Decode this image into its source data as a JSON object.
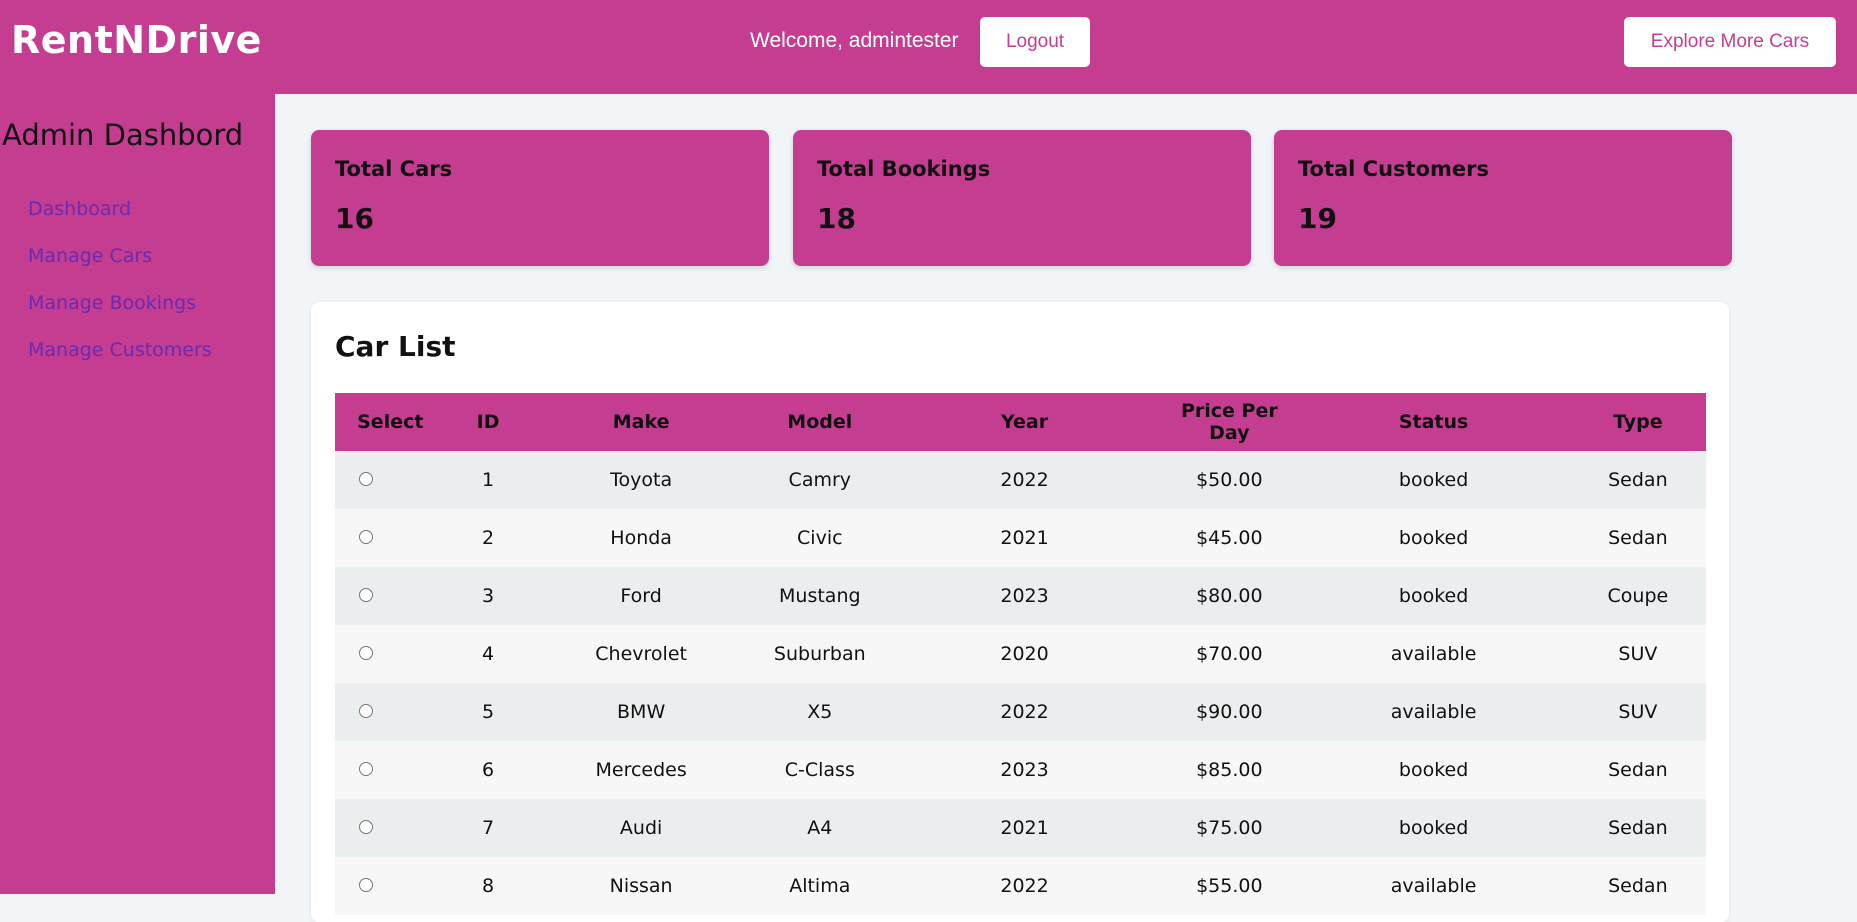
{
  "header": {
    "brand": "RentNDrive",
    "welcome": "Welcome, admintester",
    "logout_label": "Logout",
    "explore_label": "Explore More Cars"
  },
  "sidebar": {
    "title": "Admin Dashbord",
    "items": [
      {
        "label": "Dashboard"
      },
      {
        "label": "Manage Cars"
      },
      {
        "label": "Manage Bookings"
      },
      {
        "label": "Manage Customers"
      }
    ]
  },
  "stats": [
    {
      "label": "Total Cars",
      "value": "16"
    },
    {
      "label": "Total Bookings",
      "value": "18"
    },
    {
      "label": "Total Customers",
      "value": "19"
    }
  ],
  "car_list": {
    "title": "Car List",
    "columns": [
      "Select",
      "ID",
      "Make",
      "Model",
      "Year",
      "Price Per Day",
      "Status",
      "Type"
    ],
    "rows": [
      {
        "id": "1",
        "make": "Toyota",
        "model": "Camry",
        "year": "2022",
        "price": "$50.00",
        "status": "booked",
        "type": "Sedan"
      },
      {
        "id": "2",
        "make": "Honda",
        "model": "Civic",
        "year": "2021",
        "price": "$45.00",
        "status": "booked",
        "type": "Sedan"
      },
      {
        "id": "3",
        "make": "Ford",
        "model": "Mustang",
        "year": "2023",
        "price": "$80.00",
        "status": "booked",
        "type": "Coupe"
      },
      {
        "id": "4",
        "make": "Chevrolet",
        "model": "Suburban",
        "year": "2020",
        "price": "$70.00",
        "status": "available",
        "type": "SUV"
      },
      {
        "id": "5",
        "make": "BMW",
        "model": "X5",
        "year": "2022",
        "price": "$90.00",
        "status": "available",
        "type": "SUV"
      },
      {
        "id": "6",
        "make": "Mercedes",
        "model": "C-Class",
        "year": "2023",
        "price": "$85.00",
        "status": "booked",
        "type": "Sedan"
      },
      {
        "id": "7",
        "make": "Audi",
        "model": "A4",
        "year": "2021",
        "price": "$75.00",
        "status": "booked",
        "type": "Sedan"
      },
      {
        "id": "8",
        "make": "Nissan",
        "model": "Altima",
        "year": "2022",
        "price": "$55.00",
        "status": "available",
        "type": "Sedan"
      }
    ]
  },
  "colors": {
    "brand": "#c53d91",
    "nav_link": "#6a2bb0",
    "background": "#f2f5f8"
  }
}
